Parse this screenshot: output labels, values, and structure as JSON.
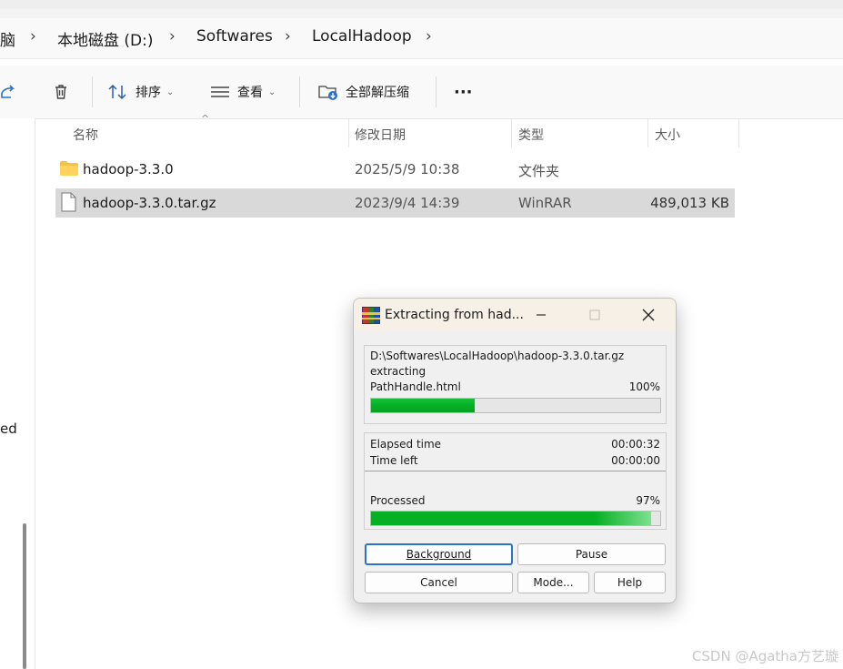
{
  "address_bar": {
    "crumbs": [
      "脑",
      "本地磁盘 (D:)",
      "Softwares",
      "LocalHadoop"
    ]
  },
  "toolbar": {
    "sort_label": "排序",
    "view_label": "查看",
    "extract_all_label": "全部解压缩",
    "more_label": "···"
  },
  "left_nav": {
    "cut_text": "ed"
  },
  "columns": {
    "name": "名称",
    "modified": "修改日期",
    "type": "类型",
    "size": "大小"
  },
  "files": [
    {
      "name": "hadoop-3.3.0",
      "modified": "2025/5/9 10:38",
      "type": "文件夹",
      "size": "",
      "icon": "folder-icon"
    },
    {
      "name": "hadoop-3.3.0.tar.gz",
      "modified": "2023/9/4 14:39",
      "type": "WinRAR",
      "size": "489,013 KB",
      "icon": "file-icon",
      "selected": true
    }
  ],
  "dialog": {
    "title": "Extracting from had...",
    "archive_path": "D:\\Softwares\\LocalHadoop\\hadoop-3.3.0.tar.gz",
    "action": "extracting",
    "current_file": "PathHandle.html",
    "file_percent_label": "100%",
    "file_progress": 0.36,
    "elapsed_label": "Elapsed time",
    "elapsed_value": "00:00:32",
    "left_label": "Time left",
    "left_value": "00:00:00",
    "processed_label": "Processed",
    "processed_percent_label": "97%",
    "processed_progress": 0.97,
    "buttons": {
      "background": "Background",
      "pause": "Pause",
      "cancel": "Cancel",
      "mode": "Mode...",
      "help": "Help"
    }
  },
  "watermark": "CSDN @Agatha方艺璇",
  "colors": {
    "progress_green": "#06b025",
    "selection": "#d9d9d9",
    "accent_blue": "#2a73c7"
  }
}
